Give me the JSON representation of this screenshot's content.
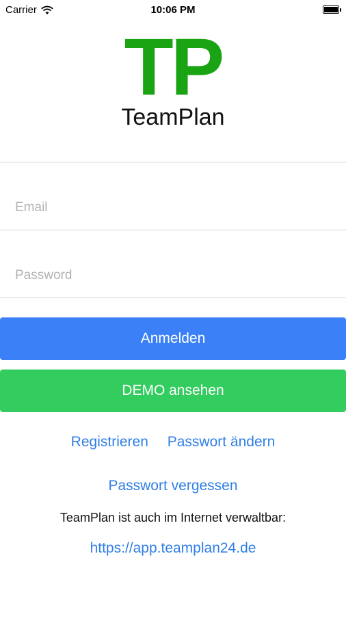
{
  "status_bar": {
    "carrier": "Carrier",
    "time": "10:06 PM"
  },
  "logo": {
    "mark": "TP",
    "name": "TeamPlan",
    "color": "#1aa414"
  },
  "form": {
    "email_placeholder": "Email",
    "password_placeholder": "Password"
  },
  "buttons": {
    "login_label": "Anmelden",
    "demo_label": "DEMO ansehen"
  },
  "links": {
    "register": "Registrieren",
    "change_password": "Passwort ändern",
    "forgot_password": "Passwort vergessen"
  },
  "footer": {
    "info_text": "TeamPlan ist auch im Internet verwaltbar:",
    "web_link": "https://app.teamplan24.de"
  },
  "colors": {
    "login_button": "#3b80f6",
    "demo_button": "#33cc5e",
    "link": "#2f7fe6"
  }
}
